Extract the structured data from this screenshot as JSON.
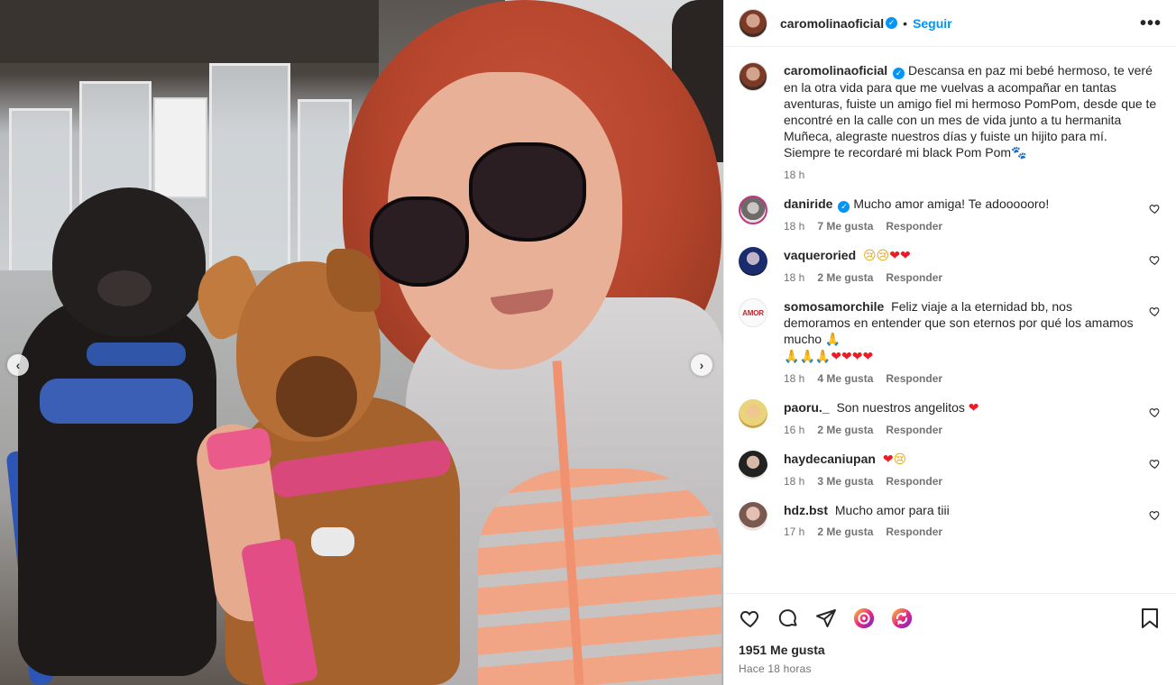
{
  "post": {
    "author": "caromolinaoficial",
    "verified": true,
    "separator": "•",
    "follow_label": "Seguir",
    "more_label": "•••"
  },
  "media": {
    "prev_label": "‹",
    "next_label": "›"
  },
  "caption": {
    "user": "caromolinaoficial",
    "text": "Descansa en paz mi bebé hermoso, te veré en la otra vida para que me vuelvas a acompañar en tantas aventuras, fuiste un amigo fiel mi hermoso PomPom, desde que te encontré en la calle con un mes de vida junto a tu hermanita Muñeca, alegraste nuestros días y fuiste un hijito para mí.",
    "text2": "Siempre te recordaré mi black Pom Pom",
    "emoji": "🐾",
    "time": "18 h"
  },
  "comments": [
    {
      "user": "daniride",
      "verified": true,
      "text": "Mucho amor amiga! Te adoooooro!",
      "time": "18 h",
      "likes": "7 Me gusta",
      "reply": "Responder",
      "avatar": "av-daniride"
    },
    {
      "user": "vaqueroried",
      "verified": false,
      "text": "",
      "emojis": [
        "😢",
        "😢",
        "❤",
        "❤"
      ],
      "time": "18 h",
      "likes": "2 Me gusta",
      "reply": "Responder",
      "avatar": "av-vaquero"
    },
    {
      "user": "somosamorchile",
      "verified": false,
      "text": "Feliz viaje a la eternidad bb, nos demoramos en entender que son eternos por qué los amamos mucho",
      "emojis": [
        "🙏",
        "🙏",
        "🙏",
        "🙏",
        "❤",
        "❤",
        "❤",
        "❤"
      ],
      "time": "18 h",
      "likes": "4 Me gusta",
      "reply": "Responder",
      "avatar": "av-somos",
      "avatar_text": "AMOR"
    },
    {
      "user": "paoru._",
      "verified": false,
      "text": "Son nuestros angelitos",
      "emojis": [
        "❤"
      ],
      "time": "16 h",
      "likes": "2 Me gusta",
      "reply": "Responder",
      "avatar": "av-paoru"
    },
    {
      "user": "haydecaniupan",
      "verified": false,
      "text": "",
      "emojis": [
        "❤",
        "😢"
      ],
      "time": "18 h",
      "likes": "3 Me gusta",
      "reply": "Responder",
      "avatar": "av-hayde"
    },
    {
      "user": "hdz.bst",
      "verified": false,
      "text": "Mucho amor para tiii",
      "time": "17 h",
      "likes": "2 Me gusta",
      "reply": "Responder",
      "avatar": "av-hdz"
    }
  ],
  "footer": {
    "likes_count": "1951 Me gusta",
    "posted": "Hace 18 horas"
  },
  "colors": {
    "accent": "#0095f6",
    "text": "#262626",
    "muted": "#737373",
    "heart": "#ed1c24"
  }
}
